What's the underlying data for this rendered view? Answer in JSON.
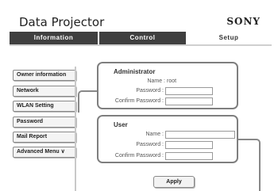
{
  "header": {
    "title": "Data Projector",
    "brand": "SONY"
  },
  "tabs": [
    {
      "label": "Information"
    },
    {
      "label": "Control"
    },
    {
      "label": "Setup"
    }
  ],
  "sidebar": {
    "items": [
      {
        "label": "Owner information"
      },
      {
        "label": "Network"
      },
      {
        "label": "WLAN Setting"
      },
      {
        "label": "Password"
      },
      {
        "label": "Mail Report"
      },
      {
        "label": "Advanced Menu ∨"
      }
    ]
  },
  "admin": {
    "title": "Administrator",
    "name_label": "Name :",
    "name_value": "root",
    "password_label": "Password :",
    "confirm_label": "Confirm Password :"
  },
  "user": {
    "title": "User",
    "name_label": "Name :",
    "password_label": "Password :",
    "confirm_label": "Confirm Password :"
  },
  "actions": {
    "apply_label": "Apply"
  }
}
